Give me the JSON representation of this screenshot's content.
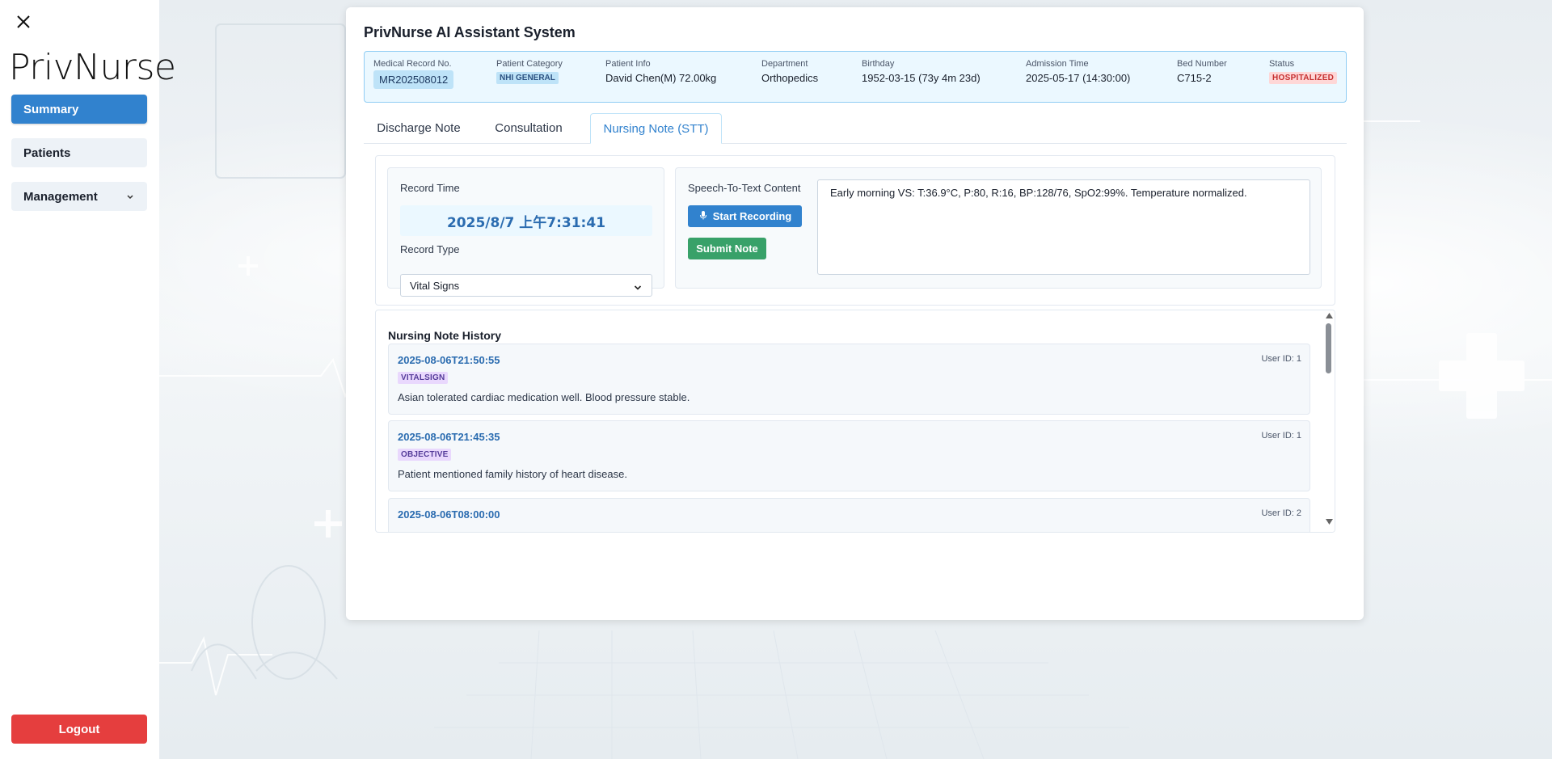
{
  "sidebar": {
    "logo": "PrivNurse",
    "nav": [
      {
        "label": "Summary"
      },
      {
        "label": "Patients"
      },
      {
        "label": "Management"
      }
    ],
    "logout_label": "Logout",
    "close_icon": "close-icon"
  },
  "header": {
    "title": "PrivNurse AI Assistant System"
  },
  "patient": {
    "medical_record_label": "Medical Record No.",
    "medical_record": "MR202508012",
    "category_label": "Patient Category",
    "category": "NHI GENERAL",
    "info_label": "Patient Info",
    "info": "David Chen(M) 72.00kg",
    "department_label": "Department",
    "department": "Orthopedics",
    "birthday_label": "Birthday",
    "birthday": "1952-03-15 (73y 4m 23d)",
    "admission_label": "Admission Time",
    "admission": "2025-05-17 (14:30:00)",
    "bed_label": "Bed Number",
    "bed": "C715-2",
    "status_label": "Status",
    "status": "HOSPITALIZED"
  },
  "tabs": [
    {
      "label": "Discharge Note",
      "active": false
    },
    {
      "label": "Consultation",
      "active": false
    },
    {
      "label": "Nursing Note (STT)",
      "active": true
    }
  ],
  "form": {
    "record_time_label": "Record Time",
    "record_time": "2025/8/7 上午7:31:41",
    "record_type_label": "Record Type",
    "record_type": "Vital Signs",
    "stt_label": "Speech-To-Text Content",
    "start_recording_label": "Start Recording",
    "submit_label": "Submit Note",
    "stt_content": "Early morning VS: T:36.9°C, P:80, R:16, BP:128/76, SpO2:99%. Temperature normalized."
  },
  "history": {
    "title": "Nursing Note History",
    "entries": [
      {
        "timestamp": "2025-08-06T21:50:55",
        "user": "User ID: 1",
        "tag": "VITALSIGN",
        "text": "Asian tolerated cardiac medication well. Blood pressure stable."
      },
      {
        "timestamp": "2025-08-06T21:45:35",
        "user": "User ID: 1",
        "tag": "OBJECTIVE",
        "text": "Patient mentioned family history of heart disease."
      },
      {
        "timestamp": "2025-08-06T08:00:00",
        "user": "User ID: 2",
        "tag": "",
        "text": ""
      }
    ]
  },
  "colors": {
    "primary": "#3182ce",
    "success": "#38a169",
    "danger": "#e53e3e"
  }
}
